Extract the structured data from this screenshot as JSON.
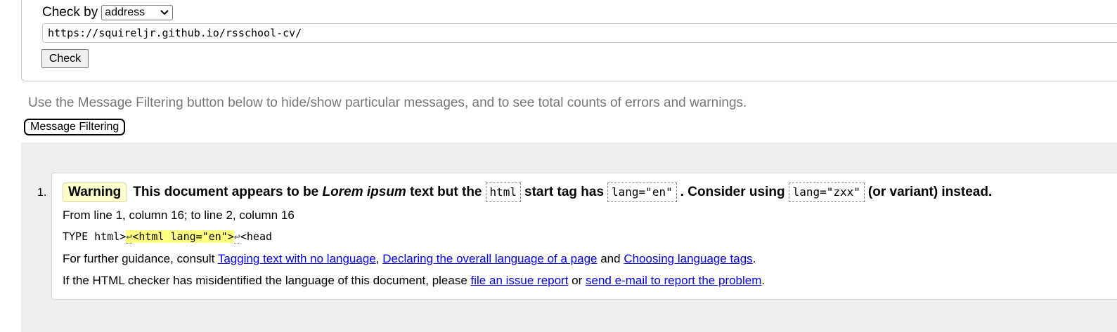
{
  "form": {
    "check_by_label": "Check by",
    "check_by_value": "address",
    "url_value": "https://squireljr.github.io/rsschool-cv/",
    "check_button": "Check"
  },
  "filter": {
    "hint": "Use the Message Filtering button below to hide/show particular messages, and to see total counts of errors and warnings.",
    "button": "Message Filtering"
  },
  "messages": [
    {
      "number": "1.",
      "type": "Warning",
      "text_1": "This document appears to be ",
      "text_em": "Lorem ipsum",
      "text_2": " text but the",
      "code_1": "html",
      "text_3": "start tag has",
      "code_2": "lang=\"en\"",
      "text_4": ". Consider using",
      "code_3": "lang=\"zxx\"",
      "text_5": "(or variant) instead.",
      "location": "From line 1, column 16; to line 2, column 16",
      "extract_before": "TYPE html>",
      "extract_lf_1": "↩",
      "extract_highlight": "<html lang=\"en\">",
      "extract_lf_2": "↩",
      "extract_after": "<head",
      "guidance_prefix": "For further guidance, consult ",
      "link_1": "Tagging text with no language",
      "sep_1": ", ",
      "link_2": "Declaring the overall language of a page",
      "sep_2": " and ",
      "link_3": "Choosing language tags",
      "sep_3": ".",
      "issue_prefix": "If the HTML checker has misidentified the language of this document, please ",
      "link_4": "file an issue report",
      "sep_4": " or ",
      "link_5": "send e-mail to report the problem",
      "sep_5": "."
    }
  ],
  "colors": {
    "warning_bg": "#ffffcc",
    "highlight": "#ffff80",
    "link": "#0000ee",
    "panel_bg": "#eeeeee"
  }
}
